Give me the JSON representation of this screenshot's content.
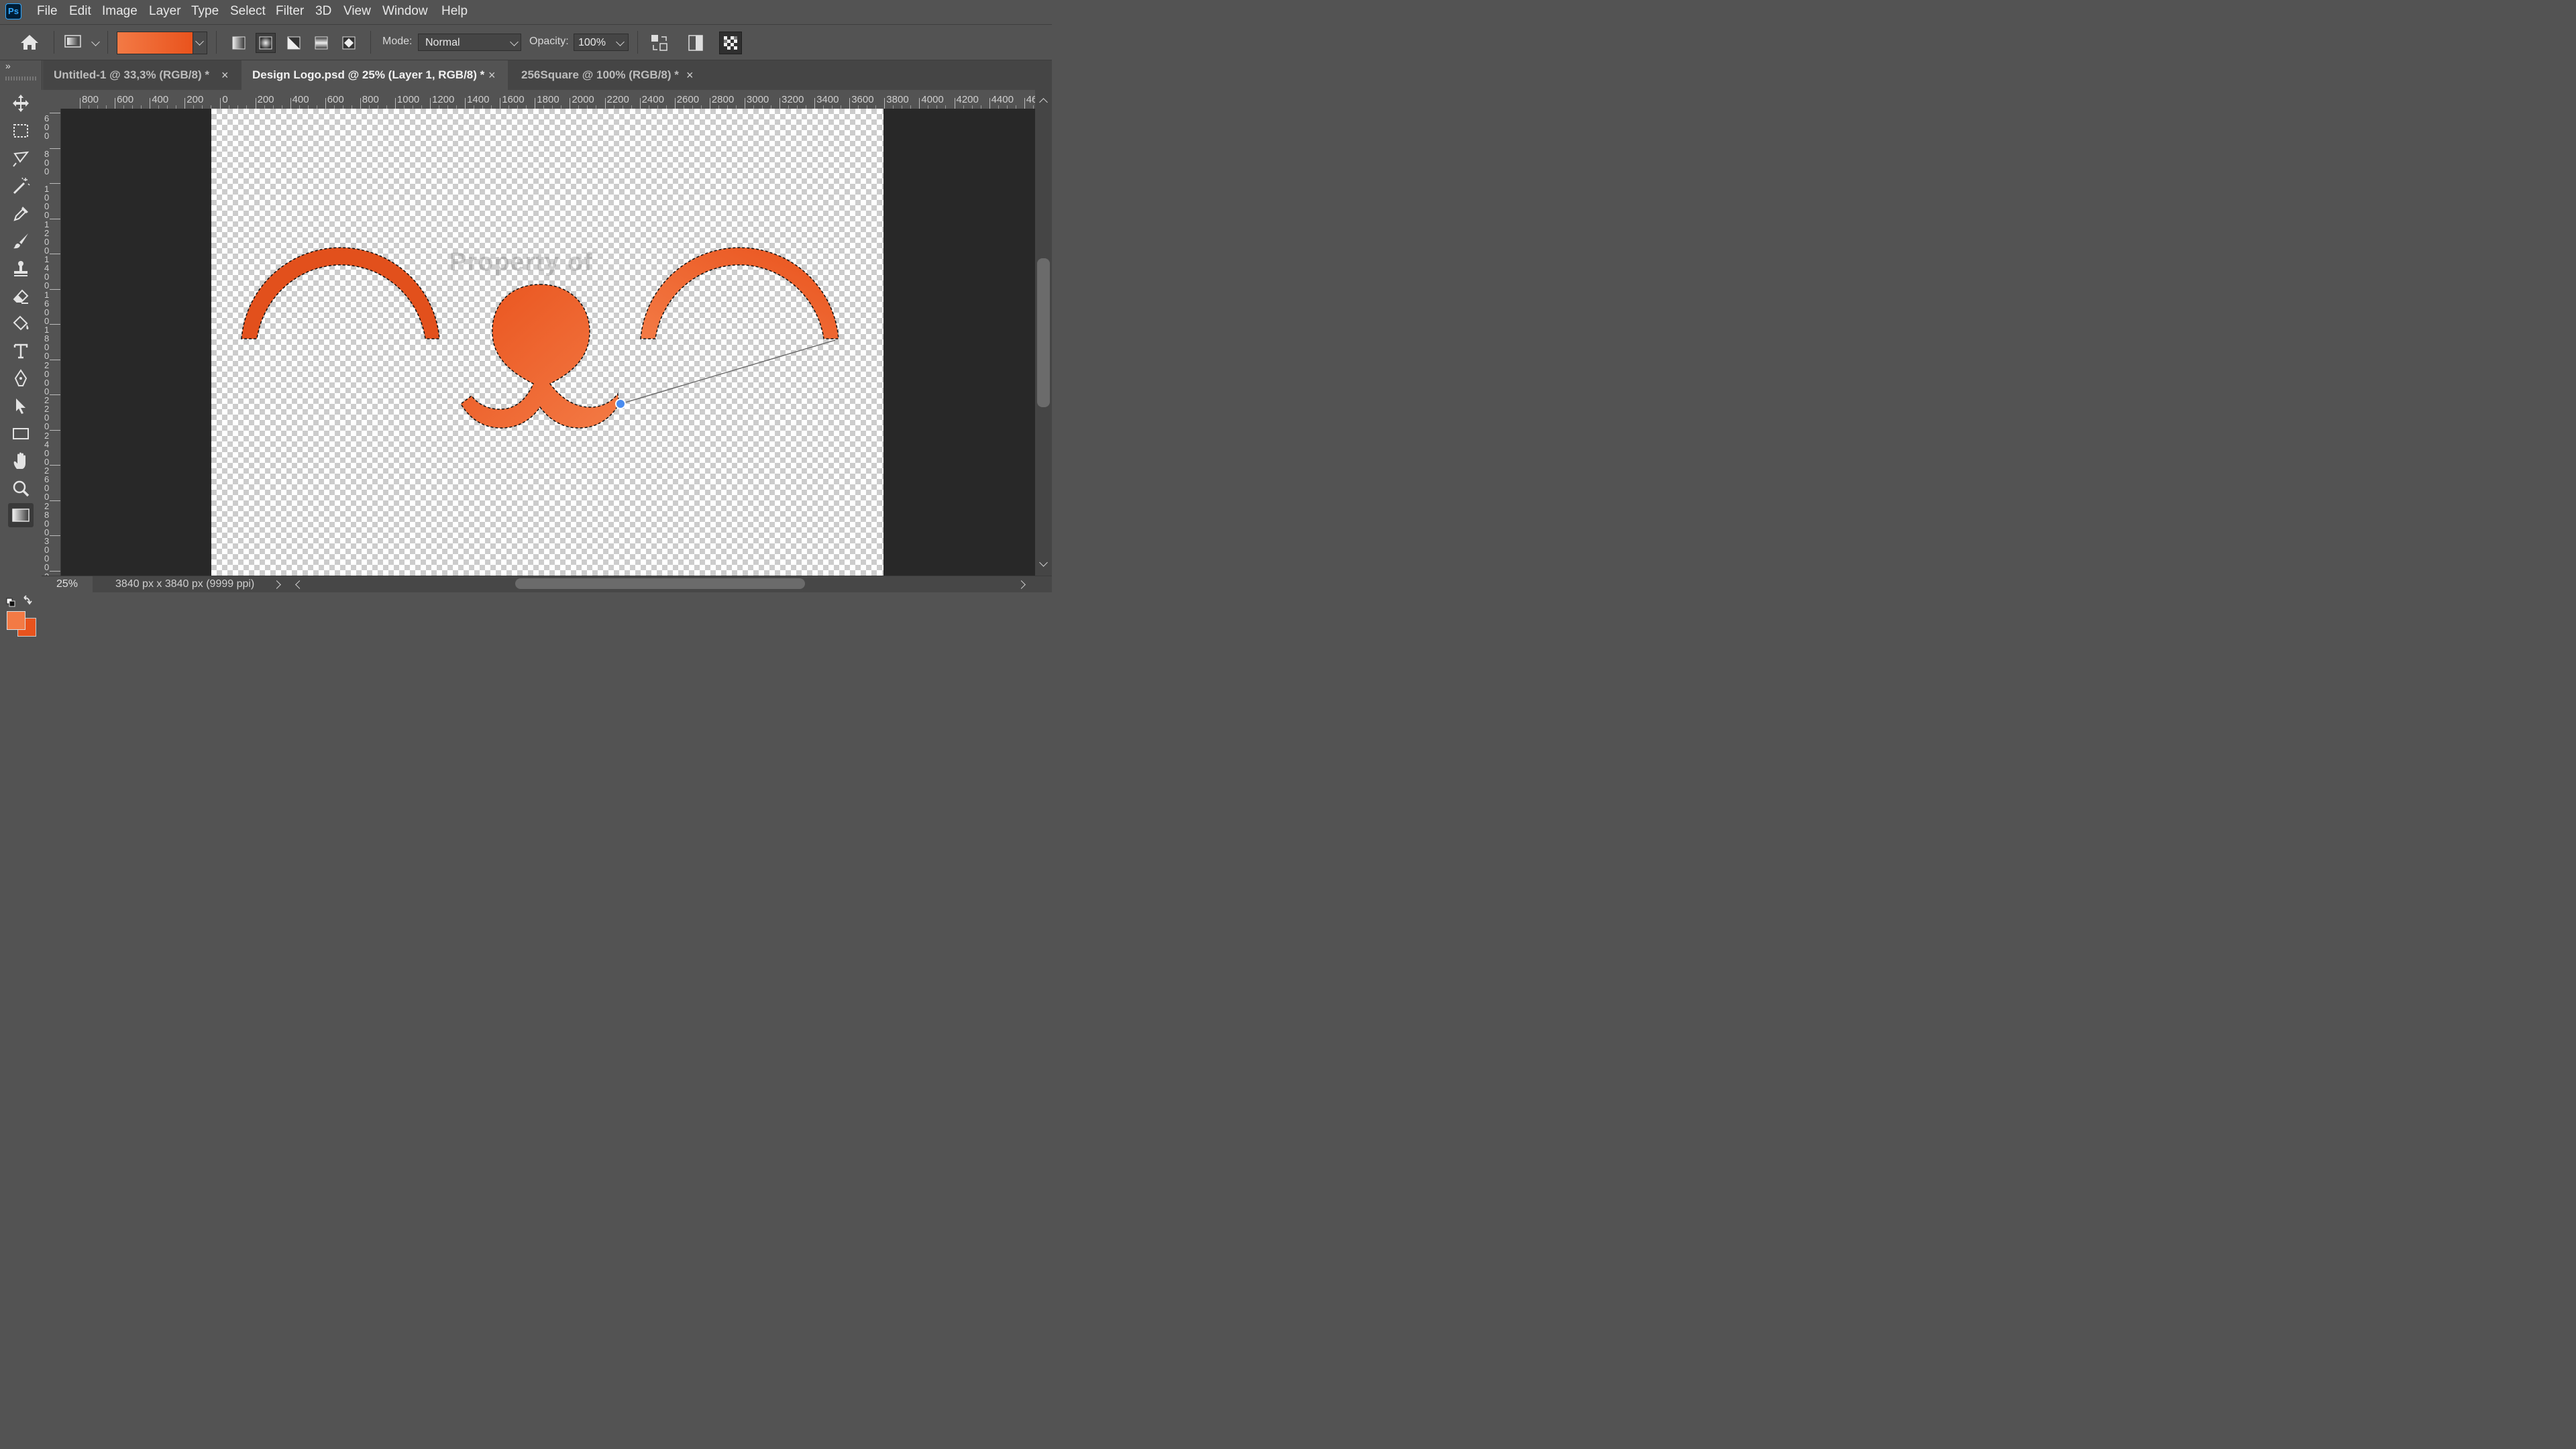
{
  "app": {
    "logo_text": "Ps",
    "accent": "#31a8ff"
  },
  "menu": [
    "File",
    "Edit",
    "Image",
    "Layer",
    "Type",
    "Select",
    "Filter",
    "3D",
    "View",
    "Window",
    "Help"
  ],
  "options": {
    "gradient_colors": [
      "#f37a45",
      "#e9531d"
    ],
    "mode_label": "Mode:",
    "mode_value": "Normal",
    "opacity_label": "Opacity:",
    "opacity_value": "100%"
  },
  "tabs": [
    {
      "label": "Untitled-1 @ 33,3% (RGB/8) *",
      "active": false
    },
    {
      "label": "Design Logo.psd @ 25% (Layer 1, RGB/8) *",
      "active": true
    },
    {
      "label": "256Square @ 100% (RGB/8) *",
      "active": false
    }
  ],
  "ruler_top_labels": [
    "800",
    "600",
    "400",
    "200",
    "0",
    "200",
    "400",
    "600",
    "800",
    "1000",
    "1200",
    "1400",
    "1600",
    "1800",
    "2000",
    "2200",
    "2400",
    "2600",
    "2800",
    "3000",
    "3200",
    "3400",
    "3600",
    "3800",
    "4000",
    "4200",
    "4400",
    "460"
  ],
  "ruler_left_labels": [
    "600",
    "800",
    "1000",
    "1200",
    "1400",
    "1600",
    "1800",
    "2000",
    "2200",
    "2400",
    "2600",
    "2800",
    "3000",
    "3"
  ],
  "tools": [
    "move-tool",
    "marquee-tool",
    "lasso-tool",
    "magic-wand-tool",
    "eyedropper-tool",
    "brush-tool",
    "stamp-tool",
    "eraser-tool",
    "paint-bucket-tool",
    "type-tool",
    "pen-tool",
    "path-select-tool",
    "rectangle-tool",
    "hand-tool",
    "zoom-tool",
    "gradient-tool"
  ],
  "canvas": {
    "watermark": "Property of"
  },
  "colors": {
    "foreground": "#f37a45",
    "background": "#e9531d",
    "artwork": "#e9531d"
  },
  "status": {
    "zoom": "25%",
    "doc_info": "3840 px x 3840 px (9999 ppi)"
  }
}
